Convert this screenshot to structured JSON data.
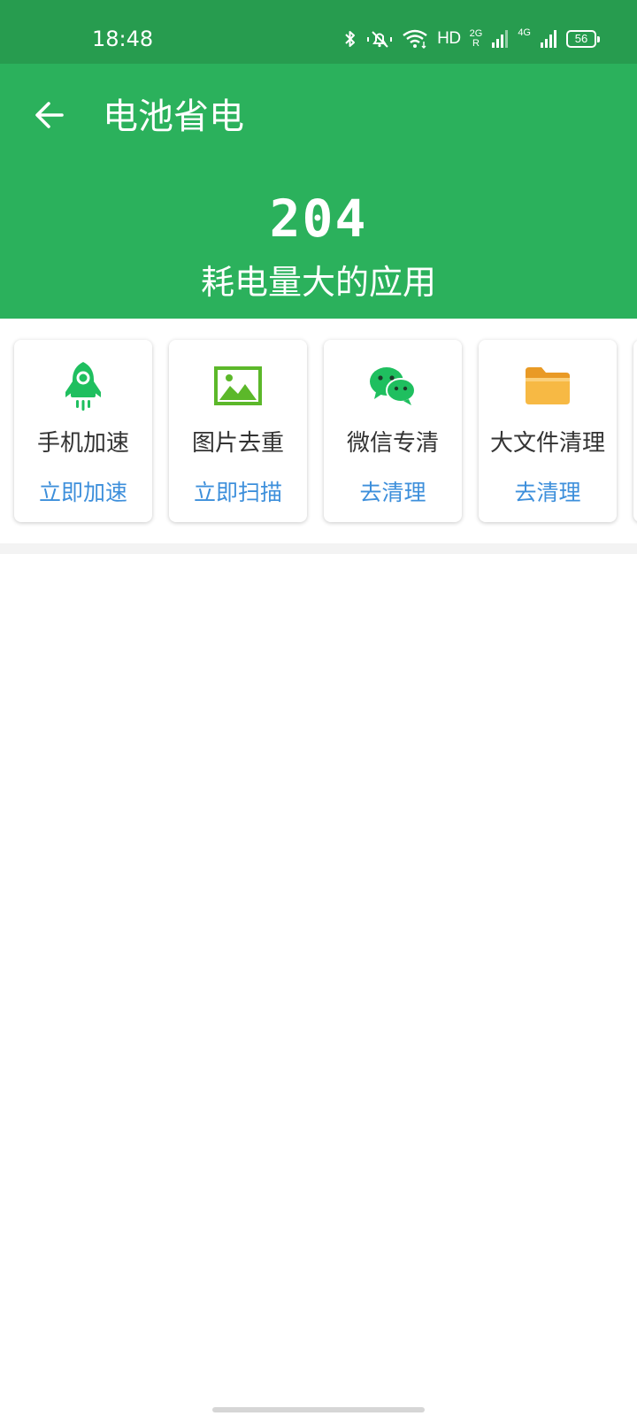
{
  "status_bar": {
    "time": "18:48",
    "hd_label": "HD",
    "sim1_label": "2G",
    "sim1_roaming": "R",
    "sim2_label": "4G",
    "battery_level": "56",
    "icons": [
      "bluetooth-icon",
      "mute-bell-icon",
      "wifi-icon",
      "signal-icon",
      "signal-icon",
      "battery-icon"
    ]
  },
  "header": {
    "back_icon": "back-arrow-icon",
    "title": "电池省电",
    "count": "204",
    "caption": "耗电量大的应用"
  },
  "tools": [
    {
      "icon": "rocket-icon",
      "title": "手机加速",
      "action": "立即加速"
    },
    {
      "icon": "image-icon",
      "title": "图片去重",
      "action": "立即扫描"
    },
    {
      "icon": "wechat-icon",
      "title": "微信专清",
      "action": "去清理"
    },
    {
      "icon": "folder-icon",
      "title": "大文件清理",
      "action": "去清理"
    }
  ],
  "colors": {
    "status_bar": "#279c4f",
    "header": "#2bb15c",
    "action_text": "#3d8fdb",
    "icon_green": "#1fbf5f",
    "folder": "#f5b43a"
  }
}
